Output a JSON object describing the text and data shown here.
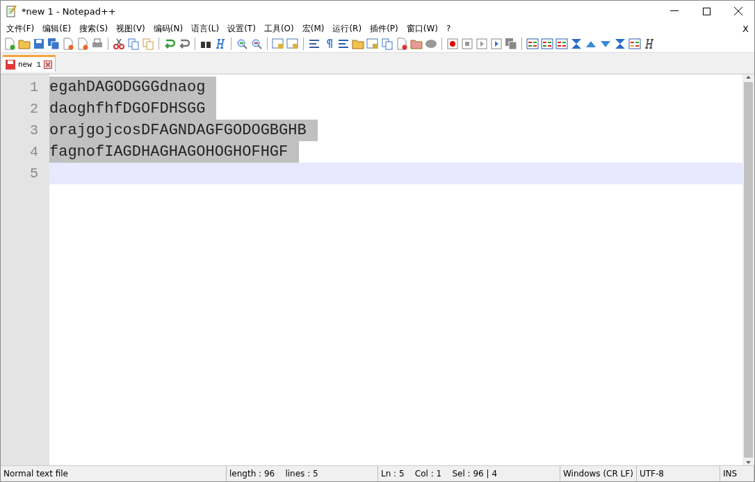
{
  "window": {
    "title": "*new 1 - Notepad++",
    "close_document": "X"
  },
  "menu": [
    {
      "label": "文件(F)"
    },
    {
      "label": "编辑(E)"
    },
    {
      "label": "搜索(S)"
    },
    {
      "label": "视图(V)"
    },
    {
      "label": "编码(N)"
    },
    {
      "label": "语言(L)"
    },
    {
      "label": "设置(T)"
    },
    {
      "label": "工具(O)"
    },
    {
      "label": "宏(M)"
    },
    {
      "label": "运行(R)"
    },
    {
      "label": "插件(P)"
    },
    {
      "label": "窗口(W)"
    },
    {
      "label": "?"
    }
  ],
  "tabs": [
    {
      "label": "new 1",
      "selected": true,
      "modified": true
    }
  ],
  "editor": {
    "lines": [
      {
        "number": "1",
        "text": "egahDAGODGGGdnaog",
        "selected": true,
        "current": false
      },
      {
        "number": "2",
        "text": "daoghfhfDGOFDHSGG",
        "selected": true,
        "current": false
      },
      {
        "number": "3",
        "text": "orajgojcosDFAGNDAGFGODOGBGHB",
        "selected": true,
        "current": false
      },
      {
        "number": "4",
        "text": "fagnofIAGDHAGHAGOHOGHOFHGF",
        "selected": true,
        "current": false
      },
      {
        "number": "5",
        "selected": false,
        "current": true
      }
    ]
  },
  "status_bar": [
    {
      "text": "Normal text file"
    },
    {
      "text": "length : 96    lines : 5"
    },
    {
      "text": "Ln : 5    Col : 1    Sel : 96 | 4"
    },
    {
      "text": "Windows (CR LF)"
    },
    {
      "text": "UTF-8"
    },
    {
      "text": "INS"
    }
  ]
}
